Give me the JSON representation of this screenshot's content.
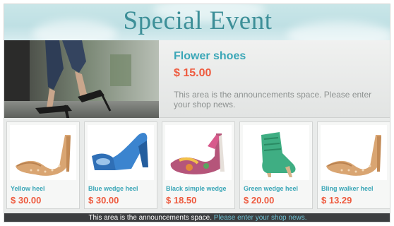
{
  "banner": {
    "title": "Special Event"
  },
  "featured": {
    "name": "Flower shoes",
    "price": "$ 15.00",
    "note": "This area is the announcements space. Please enter your shop news."
  },
  "products": [
    {
      "name": "Yellow heel",
      "price": "$ 30.00",
      "shoe_color": "#d9a572",
      "icon": "studded-pump-icon"
    },
    {
      "name": "Blue wedge heel",
      "price": "$ 30.00",
      "shoe_color": "#2f6fb6",
      "icon": "wedge-heel-icon"
    },
    {
      "name": "Black simple wedge",
      "price": "$ 18.50",
      "shoe_color": "#b5557a",
      "icon": "floral-heel-icon"
    },
    {
      "name": "Green wedge heel",
      "price": "$ 20.00",
      "shoe_color": "#3fae83",
      "icon": "bootie-icon"
    },
    {
      "name": "Bling walker heel",
      "price": "$ 13.29",
      "shoe_color": "#d9a572",
      "icon": "studded-pump-icon"
    }
  ],
  "ticker": {
    "part1": "This area is the announcements space.",
    "part2": "Please enter your shop news."
  },
  "colors": {
    "accent": "#3aa6b7",
    "price": "#ee5a3e",
    "title": "#3d8f98"
  }
}
